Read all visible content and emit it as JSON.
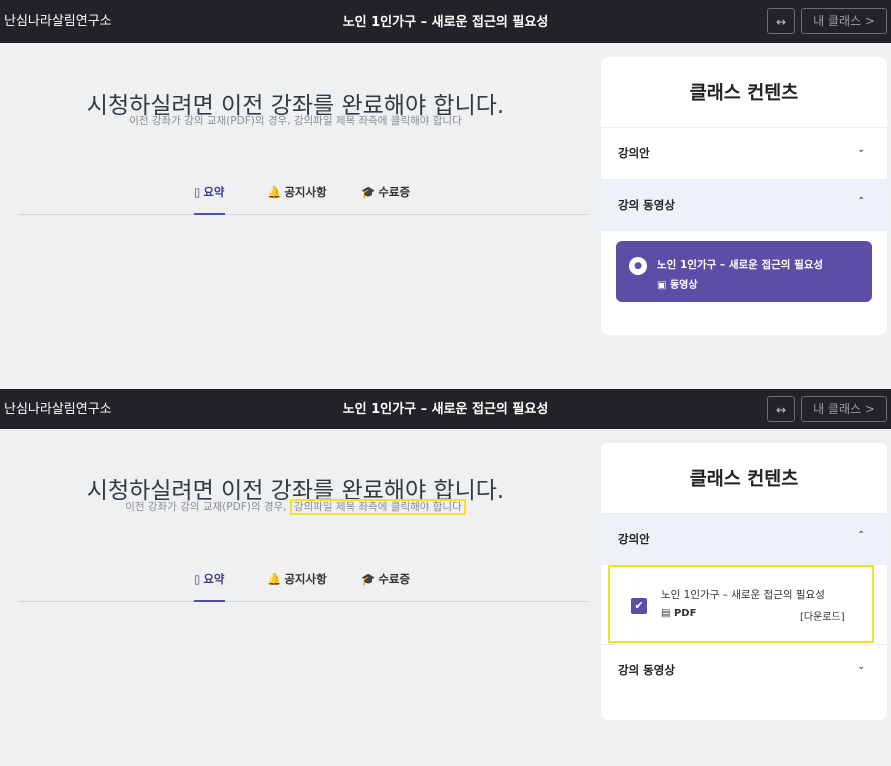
{
  "header": {
    "logo_text": "난심나라살림연구소",
    "title": "노인 1인가구 – 새로운 접근의 필요성",
    "resize_icon": "↔",
    "my_class_label": "내 클래스 >"
  },
  "main": {
    "headline": "시청하실려면 이전 강좌를 완료해야 합니다.",
    "subline_prefix": "이전 강좌가 강의 교재(PDF)의 경우,",
    "subline_highlight": "강의파일 제목 좌측에 클릭해야 합니다",
    "tabs": [
      {
        "icon": "▯",
        "label": "요약"
      },
      {
        "icon": "🔔",
        "label": "공지사항"
      },
      {
        "icon": "🎓",
        "label": "수료증"
      }
    ]
  },
  "sidebar": {
    "heading": "클래스 컨텐츠",
    "sections": [
      {
        "label": "강의안",
        "chev_closed": "⌄",
        "chev_open": "⌃"
      },
      {
        "label": "강의 동영상",
        "chev_closed": "⌄",
        "chev_open": "⌃"
      }
    ],
    "video_item": {
      "title": "노인 1인가구 – 새로운 접근의 필요성",
      "type": "동영상",
      "lock_icon": "lock-icon"
    },
    "pdf_item": {
      "title": "노인 1인가구 – 새로운 접근의 필요성",
      "type": "PDF",
      "download_label": "[다운로드]",
      "checked": true
    }
  },
  "colors": {
    "topbar": "#222326",
    "accent": "#5b4ea6",
    "highlight": "#f2e02a"
  }
}
